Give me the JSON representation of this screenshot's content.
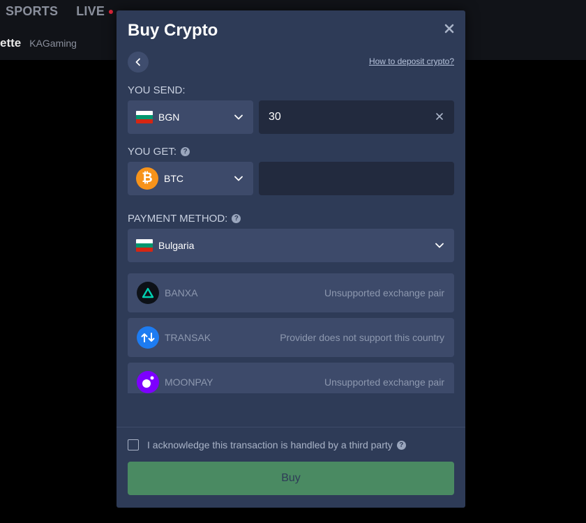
{
  "background": {
    "nav": [
      "SPORTS",
      "LIVE"
    ],
    "game_name": "ette",
    "game_provider": "KAGaming"
  },
  "modal": {
    "title": "Buy Crypto",
    "help_link": "How to deposit crypto?",
    "you_send_label": "YOU SEND:",
    "send_currency": "BGN",
    "send_amount": "30",
    "you_get_label": "YOU GET:",
    "get_currency": "BTC",
    "get_amount": "",
    "payment_method_label": "PAYMENT METHOD:",
    "payment_country": "Bulgaria",
    "providers": [
      {
        "name": "BANXA",
        "status": "Unsupported exchange pair",
        "icon": "banxa-logo-icon"
      },
      {
        "name": "TRANSAK",
        "status": "Provider does not support this country",
        "icon": "transak-logo-icon"
      },
      {
        "name": "MOONPAY",
        "status": "Unsupported exchange pair",
        "icon": "moonpay-logo-icon"
      }
    ],
    "acknowledge_text": "I acknowledge this transaction is handled by a third party",
    "buy_label": "Buy"
  },
  "colors": {
    "modal_bg": "#2e3b57",
    "field_bg": "#222a3e",
    "select_bg": "#3d4a6a",
    "buy_button": "#4a8a62",
    "btc_orange": "#f7931a",
    "live_dot": "#e0263a"
  }
}
